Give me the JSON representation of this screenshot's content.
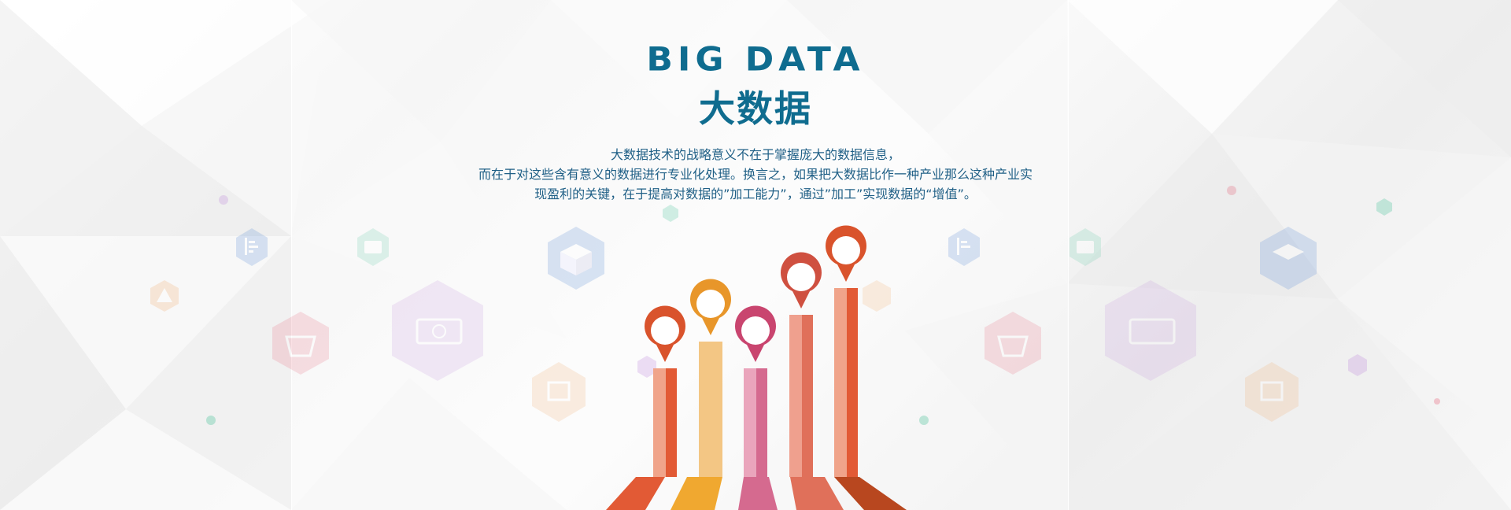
{
  "header": {
    "title_en": "BIG DATA",
    "title_zh": "大数据"
  },
  "description": {
    "line1": "大数据技术的战略意义不在于掌握庞大的数据信息，",
    "line2": "而在于对这些含有意义的数据进行专业化处理。换言之，如果把大数据比作一种产业那么这种产业实",
    "line3": "现盈利的关键，在于提高对数据的”加工能力”，通过”加工”实现数据的“增值”。"
  },
  "colors": {
    "title": "#0f6c8f",
    "text": "#1f5f86",
    "bar_red": "#e25a35",
    "bar_orange": "#f0a830",
    "bar_pink": "#d56a8f",
    "bar_salmon": "#e0705a",
    "bar_darkorange": "#d9532c"
  },
  "icons": [
    {
      "name": "chart-icon",
      "color": "#5b8ed6"
    },
    {
      "name": "wallet-icon",
      "color": "#4cc39a"
    },
    {
      "name": "box-icon",
      "color": "#5b8ed6"
    },
    {
      "name": "warning-icon",
      "color": "#f0a05a"
    },
    {
      "name": "basket-icon",
      "color": "#e5556d"
    },
    {
      "name": "money-icon",
      "color": "#b77ad8"
    },
    {
      "name": "gift-icon",
      "color": "#f0a05a"
    }
  ]
}
